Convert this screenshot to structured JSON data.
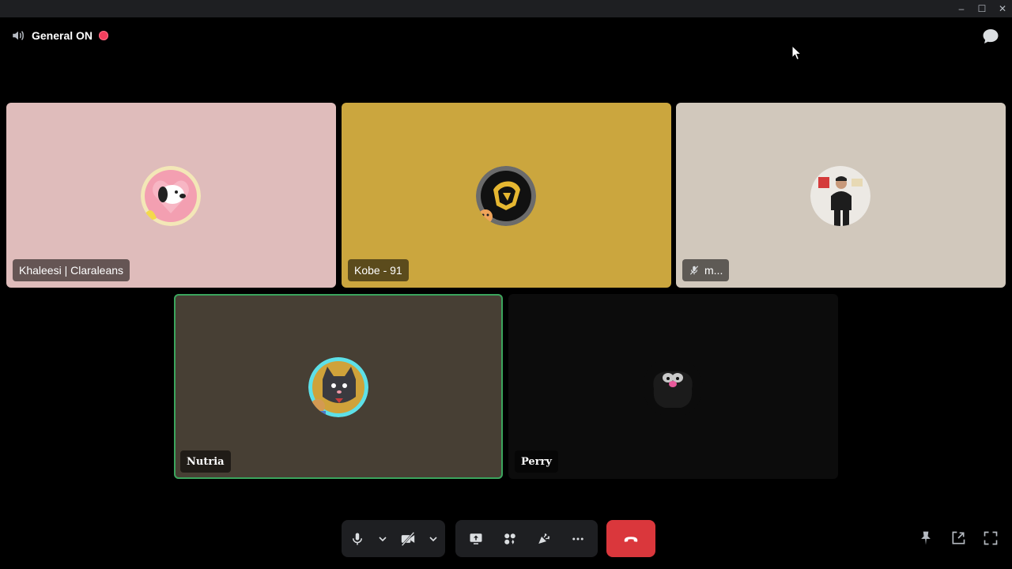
{
  "window": {
    "minimize": "–",
    "maximize": "☐",
    "close": "✕"
  },
  "channel": {
    "name": "General ON"
  },
  "colors": {
    "tile_pink": "#dfbcbb",
    "tile_gold": "#cba63e",
    "tile_beige": "#d1c8bc",
    "tile_brown": "#473f34",
    "tile_dark": "#0c0c0c",
    "speaking": "#3ba55d",
    "hangup": "#da373c",
    "toolbar": "#1e1f22"
  },
  "participants": [
    {
      "name": "Khaleesi | Claraleans",
      "avatar": "snoopy-avatar",
      "speaking": false,
      "muted": false
    },
    {
      "name": "Kobe - 91",
      "avatar": "gold-emblem-avatar",
      "speaking": false,
      "muted": false
    },
    {
      "name": "m...",
      "avatar": "person-photo-avatar",
      "speaking": false,
      "muted": true
    },
    {
      "name": "Nutria",
      "avatar": "cat-avatar",
      "speaking": true,
      "muted": false
    },
    {
      "name": "Perry",
      "avatar": "dark-creature-avatar",
      "speaking": false,
      "muted": false
    }
  ],
  "toolbar": {
    "icons": [
      "microphone-icon",
      "camera-off-icon",
      "screen-share-icon",
      "activities-icon",
      "soundboard-icon",
      "more-icon",
      "hang-up-icon",
      "pin-icon",
      "pop-out-icon",
      "fullscreen-icon"
    ]
  }
}
